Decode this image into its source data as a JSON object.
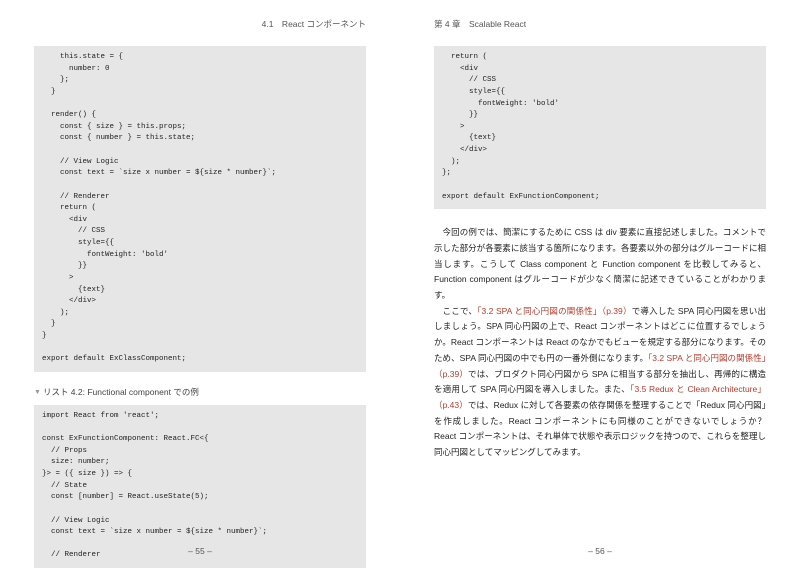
{
  "left": {
    "header": "4.1　React コンポーネント",
    "code1": "    this.state = {\n      number: 0\n    };\n  }\n\n  render() {\n    const { size } = this.props;\n    const { number } = this.state;\n\n    // View Logic\n    const text = `size x number = ${size * number}`;\n\n    // Renderer\n    return (\n      <div\n        // CSS\n        style={{\n          fontWeight: 'bold'\n        }}\n      >\n        {text}\n      </div>\n    );\n  }\n}\n\nexport default ExClassComponent;",
    "listing": "リスト 4.2: Functional component での例",
    "code2": "import React from 'react';\n\nconst ExFunctionComponent: React.FC<{\n  // Props\n  size: number;\n}> = ({ size }) => {\n  // State\n  const [number] = React.useState(5);\n\n  // View Logic\n  const text = `size x number = ${size * number}`;\n\n  // Renderer",
    "pagenum": "– 55 –"
  },
  "right": {
    "header": "第 4 章　Scalable React",
    "code1": "  return (\n    <div\n      // CSS\n      style={{\n        fontWeight: 'bold'\n      }}\n    >\n      {text}\n    </div>\n  );\n};\n\nexport default ExFunctionComponent;",
    "para1a": "今回の例では、簡潔にするために CSS は div 要素に直接記述しました。コメントで示した部分が各要素に該当する箇所になります。各要素以外の部分はグルーコードに相当します。こうして Class component と Function component を比較してみると、Function component はグルーコードが少なく簡潔に記述できていることがわかります。",
    "para2_pre": "ここで、",
    "ref1": "「3.2 SPA と同心円図の関係性」（p.39）",
    "para2_mid1": "で導入した SPA 同心円図を思い出しましょう。SPA 同心円図の上で、React コンポーネントはどこに位置するでしょうか。React コンポーネントは React のなかでもビューを規定する部分になります。そのため、SPA 同心円図の中でも円の一番外側になります。",
    "ref2": "「3.2 SPA と同心円図の関係性」（p.39）",
    "para2_mid2": "では、プロダクト同心円図から SPA に相当する部分を抽出し、再帰的に構造を適用して SPA 同心円図を導入しました。また、",
    "ref3": "「3.5 Redux と Clean Architecture」（p.43）",
    "para2_end": "では、Redux に対して各要素の依存関係を整理することで「Redux 同心円図」を作成しました。React コンポーネントにも同様のことができないでしょうか？　React コンポーネントは、それ単体で状態や表示ロジックを持つので、これらを整理し同心円図としてマッピングしてみます。",
    "pagenum": "– 56 –"
  }
}
